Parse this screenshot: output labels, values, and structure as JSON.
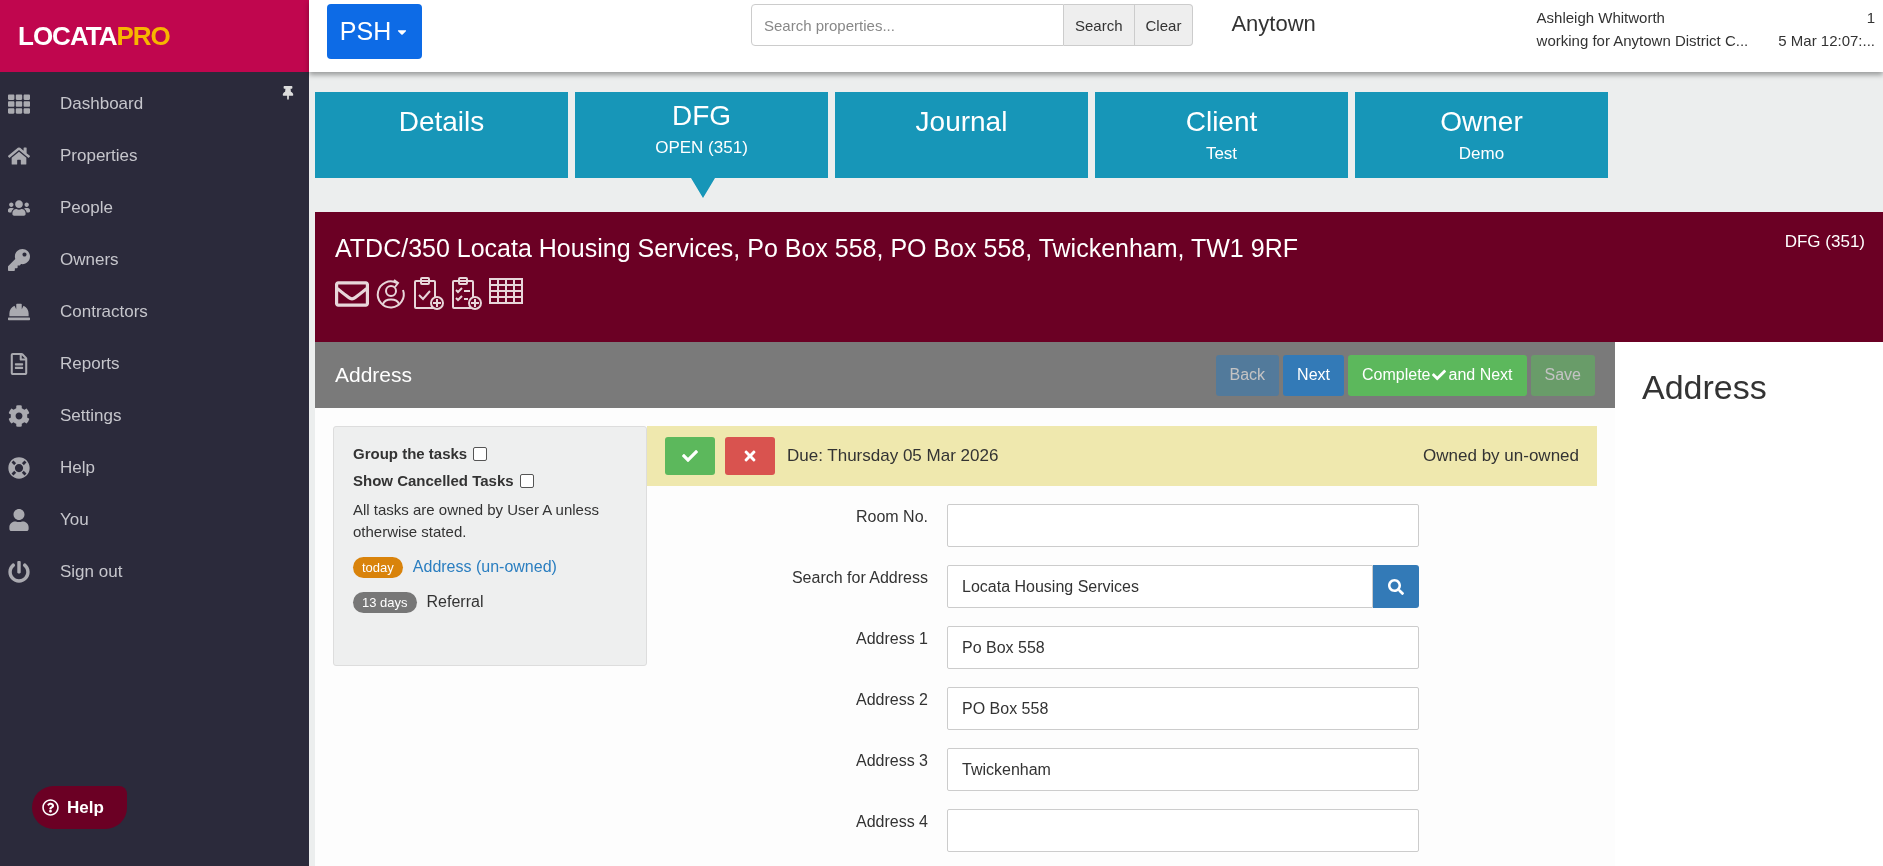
{
  "logo": {
    "part_1": "LOCATA",
    "part_2": "PRO"
  },
  "sidebar": {
    "items": [
      {
        "label": "Dashboard",
        "pinned": true
      },
      {
        "label": "Properties",
        "pinned": false
      },
      {
        "label": "People",
        "pinned": false
      },
      {
        "label": "Owners",
        "pinned": false
      },
      {
        "label": "Contractors",
        "pinned": false
      },
      {
        "label": "Reports",
        "pinned": false
      },
      {
        "label": "Settings",
        "pinned": false
      },
      {
        "label": "Help",
        "pinned": false
      },
      {
        "label": "You",
        "pinned": false
      },
      {
        "label": "Sign out",
        "pinned": false
      }
    ],
    "help_button": "Help"
  },
  "topbar": {
    "menu_button": "PSH",
    "search": {
      "placeholder": "Search properties..."
    },
    "search_button": "Search",
    "clear_button": "Clear",
    "location": "Anytown",
    "user_name": "Ashleigh Whitworth",
    "user_org": "working for Anytown District C...",
    "count": "1",
    "datetime": "5 Mar 12:07:..."
  },
  "tabs": [
    {
      "title": "Details",
      "selected": false
    },
    {
      "title": "DFG",
      "subtitle": "OPEN (351)",
      "selected": true
    },
    {
      "title": "Journal",
      "selected": false
    },
    {
      "title": "Client",
      "subtitle": "Test",
      "selected": false
    },
    {
      "title": "Owner",
      "subtitle": "Demo",
      "selected": false
    }
  ],
  "banner": {
    "title": "ATDC/350 Locata Housing Services, Po Box 558, PO Box 558, Twickenham, TW1 9RF",
    "tag": "DFG (351)"
  },
  "section": {
    "title": "Address",
    "buttons": [
      {
        "kind": "back",
        "label": "Back",
        "disabled": true
      },
      {
        "kind": "next",
        "label": "Next",
        "disabled": false
      },
      {
        "kind": "complete",
        "label": "Complete",
        "label_after": "and Next",
        "disabled": false
      },
      {
        "kind": "save",
        "label": "Save",
        "disabled": true
      }
    ]
  },
  "task_panel": {
    "options": [
      {
        "label": "Group the tasks",
        "checked": false
      },
      {
        "label": "Show Cancelled Tasks",
        "checked": false
      }
    ],
    "note": "All tasks are owned by User A unless otherwise stated.",
    "tasks": [
      {
        "badge": "today",
        "color": "#d9830b",
        "label": "Address (un-owned)",
        "selected": true
      },
      {
        "badge": "13 days",
        "color": "#777777",
        "label": "Referral",
        "selected": false
      }
    ]
  },
  "task_bar": {
    "due": "Due: Thursday 05 Mar 2026",
    "owner": "Owned by un-owned"
  },
  "form": [
    {
      "label": "Room No.",
      "kind": "text"
    },
    {
      "label": "Search for Address",
      "value": "Locata Housing Services",
      "kind": "search"
    },
    {
      "label": "Address 1",
      "value": "Po Box 558",
      "kind": "text"
    },
    {
      "label": "Address 2",
      "value": "PO Box 558",
      "kind": "text"
    },
    {
      "label": "Address 3",
      "value": "Twickenham",
      "kind": "text"
    },
    {
      "label": "Address 4",
      "kind": "text"
    }
  ],
  "side_panel": {
    "title": "Address"
  }
}
